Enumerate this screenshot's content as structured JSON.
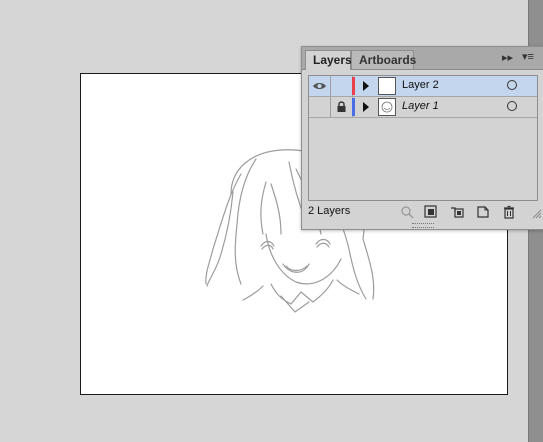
{
  "panel": {
    "tabs": [
      {
        "label": "Layers",
        "active": true
      },
      {
        "label": "Artboards",
        "active": false
      }
    ],
    "collapse_icon": "double-chevron-right-icon",
    "menu_icon": "panel-menu-icon",
    "layers": [
      {
        "name": "Layer 2",
        "visible": true,
        "locked": false,
        "color": "#e8414a",
        "selected": true,
        "thumbnail": "blank"
      },
      {
        "name": "Layer 1",
        "visible": false,
        "locked": true,
        "color": "#4a6ee8",
        "selected": false,
        "thumbnail": "sketch"
      }
    ],
    "footer": {
      "count_label": "2 Layers",
      "icons": [
        "locate-object-icon",
        "make-clipping-mask-icon",
        "create-sublayer-icon",
        "new-layer-icon",
        "trash-icon"
      ]
    }
  },
  "colors": {
    "canvas_bg": "#d6d6d6",
    "selection": "#c3d6ee"
  }
}
